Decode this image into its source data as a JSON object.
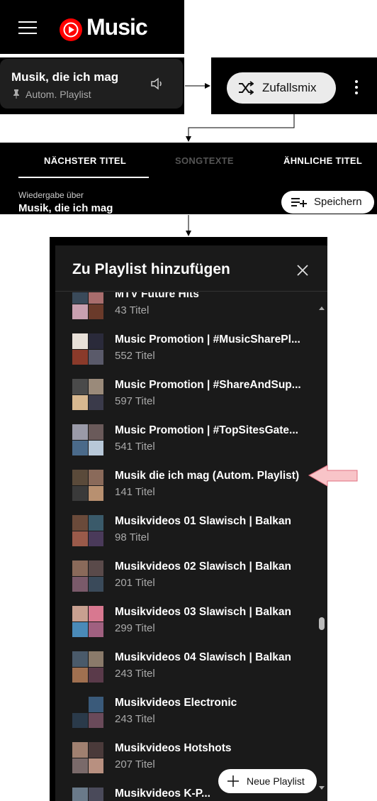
{
  "header": {
    "logo_text": "Music"
  },
  "now_playing": {
    "title": "Musik, die ich mag",
    "subtitle": "Autom. Playlist"
  },
  "shuffle": {
    "label": "Zufallsmix"
  },
  "tabs": {
    "items": [
      {
        "label": "NÄCHSTER TITEL"
      },
      {
        "label": "SONGTEXTE"
      },
      {
        "label": "ÄHNLICHE TITEL"
      }
    ],
    "playback_via_label": "Wiedergabe über",
    "playback_via_value": "Musik, die ich mag",
    "save_label": "Speichern"
  },
  "dialog": {
    "title": "Zu Playlist hinzufügen",
    "new_playlist_label": "Neue Playlist",
    "playlists": [
      {
        "name": "MTV Future Hits",
        "count": "43 Titel",
        "colors": [
          "#3a4a5a",
          "#a86d6d",
          "#c9a0b0",
          "#6a3a2a"
        ]
      },
      {
        "name": "Music Promotion | #MusicSharePl...",
        "count": "552 Titel",
        "colors": [
          "#e8e0d8",
          "#2a2a3a",
          "#8a3a2a",
          "#5a5a6a"
        ]
      },
      {
        "name": "Music Promotion | #ShareAndSup...",
        "count": "597 Titel",
        "colors": [
          "#4a4a4a",
          "#9a8a7a",
          "#d8b890",
          "#3a3a4a"
        ]
      },
      {
        "name": "Music Promotion | #TopSitesGate...",
        "count": "541 Titel",
        "colors": [
          "#9a9aa8",
          "#6a5a5a",
          "#4a6a8a",
          "#b8c8d8"
        ]
      },
      {
        "name": "Musik die ich mag (Autom. Playlist)",
        "count": "141 Titel",
        "colors": [
          "#5a4a3a",
          "#8a6a5a",
          "#3a3a3a",
          "#b89070"
        ]
      },
      {
        "name": "Musikvideos 01 Slawisch | Balkan",
        "count": "98 Titel",
        "colors": [
          "#6a4a3a",
          "#3a5a6a",
          "#9a5a4a",
          "#4a3a5a"
        ]
      },
      {
        "name": "Musikvideos 02 Slawisch | Balkan",
        "count": "201 Titel",
        "colors": [
          "#8a6a5a",
          "#5a4a4a",
          "#7a5a6a",
          "#3a4a5a"
        ]
      },
      {
        "name": "Musikvideos 03 Slawisch | Balkan",
        "count": "299 Titel",
        "colors": [
          "#c8a090",
          "#d87890",
          "#4a8ab8",
          "#a06080"
        ]
      },
      {
        "name": "Musikvideos 04 Slawisch | Balkan",
        "count": "243 Titel",
        "colors": [
          "#4a5a6a",
          "#8a7a6a",
          "#a07050",
          "#5a3a4a"
        ]
      },
      {
        "name": "Musikvideos Electronic",
        "count": "243 Titel",
        "colors": [
          "#1a1a1a",
          "#3a5a7a",
          "#2a3a4a",
          "#6a4a5a"
        ]
      },
      {
        "name": "Musikvideos Hotshots",
        "count": "207 Titel",
        "colors": [
          "#a08070",
          "#4a3a3a",
          "#7a6a6a",
          "#b89080"
        ]
      },
      {
        "name": "Musikvideos K-P...",
        "count": "",
        "colors": [
          "#6a7a8a",
          "#4a4a5a",
          "#9a8a9a",
          "#5a6a7a"
        ]
      }
    ]
  }
}
